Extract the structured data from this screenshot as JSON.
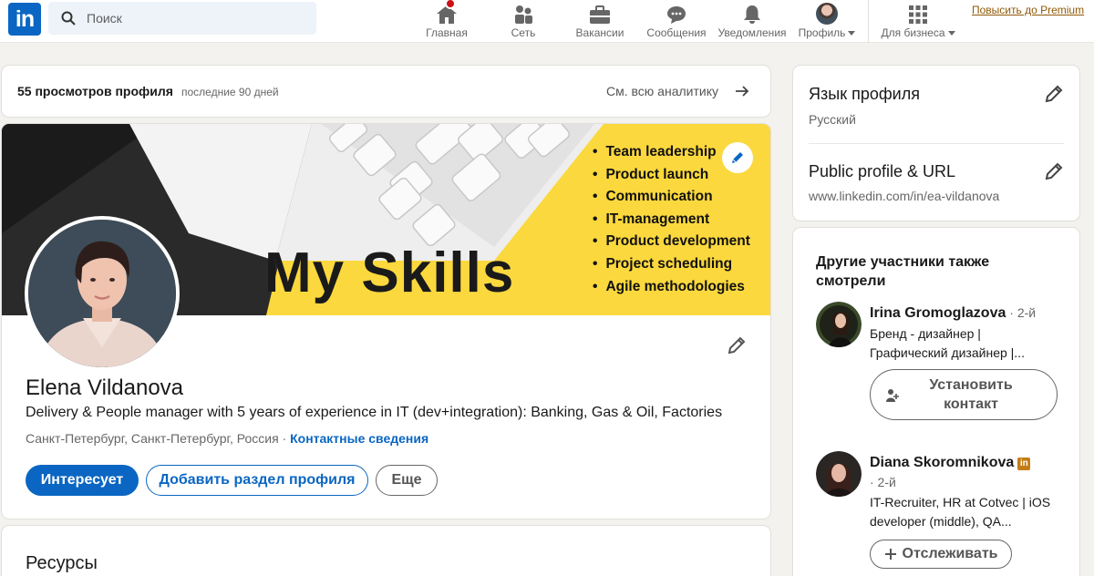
{
  "nav": {
    "search_placeholder": "Поиск",
    "items": [
      {
        "label": "Главная",
        "icon": "home-icon",
        "has_badge": true
      },
      {
        "label": "Сеть",
        "icon": "network-icon"
      },
      {
        "label": "Вакансии",
        "icon": "briefcase-icon"
      },
      {
        "label": "Сообщения",
        "icon": "messaging-icon"
      },
      {
        "label": "Уведомления",
        "icon": "bell-icon"
      },
      {
        "label": "Профиль",
        "icon": "profile-avatar"
      },
      {
        "label": "Для бизнеса",
        "icon": "grid-icon"
      }
    ],
    "premium": "Повысить до Premium"
  },
  "analytics": {
    "views": "55 просмотров профиля",
    "period": "последние 90 дней",
    "see_all": "См. всю аналитику"
  },
  "banner": {
    "title": "My  Skills",
    "skills": [
      "Team leadership",
      "Product launch",
      "Communication",
      "IT-management",
      "Product development",
      "Project scheduling",
      "Agile methodologies"
    ],
    "background_color": "#fbd83d"
  },
  "profile": {
    "name": "Elena Vildanova",
    "headline": "Delivery & People manager with 5 years of experience in IT (dev+integration): Banking, Gas & Oil, Factories",
    "location": "Санкт-Петербург, Санкт-Петербург, Россия",
    "separator": " · ",
    "contact_info": "Контактные сведения",
    "buttons": {
      "open_to": "Интересует",
      "add_section": "Добавить раздел профиля",
      "more": "Еще"
    }
  },
  "resources": {
    "title": "Ресурсы"
  },
  "sidebar": {
    "language": {
      "title": "Язык профиля",
      "value": "Русский"
    },
    "public_url": {
      "title": "Public profile & URL",
      "value": "www.linkedin.com/in/ea-vildanova"
    },
    "also_viewed": {
      "title": "Другие участники также смотрели",
      "people": [
        {
          "name": "Irina Gromoglazova",
          "degree": " · 2-й",
          "line1": "Бренд - дизайнер |",
          "line2": "Графический дизайнер |...",
          "action": "Установить контакт"
        },
        {
          "name": "Diana Skoromnikova",
          "badge": "in",
          "degree": "· 2-й",
          "line1": "IT-Recruiter, HR at Cotvec | iOS",
          "line2": "developer (middle), QA...",
          "action": "Отслеживать"
        }
      ]
    }
  },
  "colors": {
    "brand": "#0a66c2",
    "premium": "#915907",
    "notification": "#cc1016",
    "page_bg": "#f4f2ee"
  }
}
